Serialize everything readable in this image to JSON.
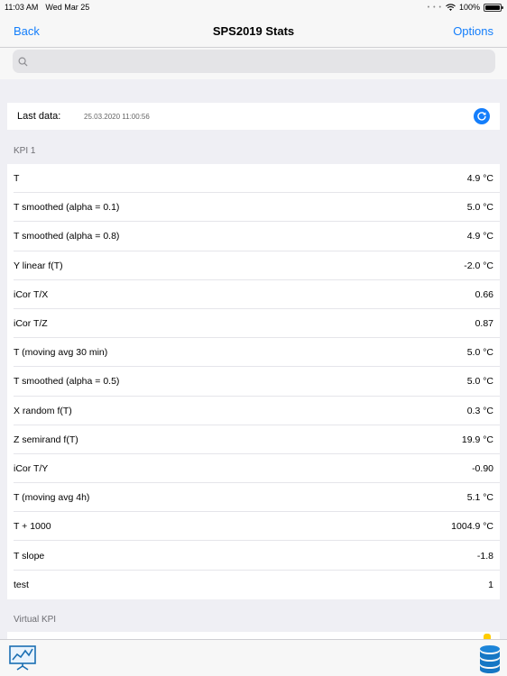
{
  "status_bar": {
    "time": "11:03 AM",
    "date": "Wed Mar 25",
    "battery": "100%",
    "battery_level": 1.0
  },
  "nav": {
    "back_label": "Back",
    "title": "SPS2019 Stats",
    "options_label": "Options"
  },
  "search": {
    "placeholder": "",
    "value": ""
  },
  "last_data": {
    "label": "Last data:",
    "value": "25.03.2020 11:00:56"
  },
  "sections": {
    "kpi1_title": "KPI 1",
    "virtual_title": "Virtual KPI"
  },
  "kpi1_rows": [
    {
      "name": "T",
      "value": "4.9 °C"
    },
    {
      "name": "T smoothed (alpha = 0.1)",
      "value": "5.0 °C"
    },
    {
      "name": "T smoothed (alpha = 0.8)",
      "value": "4.9 °C"
    },
    {
      "name": "Y linear f(T)",
      "value": "-2.0 °C"
    },
    {
      "name": "iCor T/X",
      "value": "0.66"
    },
    {
      "name": "iCor T/Z",
      "value": "0.87"
    },
    {
      "name": "T (moving avg 30 min)",
      "value": "5.0 °C"
    },
    {
      "name": "T smoothed (alpha = 0.5)",
      "value": "5.0 °C"
    },
    {
      "name": "X random f(T)",
      "value": "0.3 °C"
    },
    {
      "name": "Z semirand f(T)",
      "value": "19.9 °C"
    },
    {
      "name": "iCor T/Y",
      "value": "-0.90"
    },
    {
      "name": "T (moving avg 4h)",
      "value": "5.1 °C"
    },
    {
      "name": "T + 1000",
      "value": "1004.9 °C"
    },
    {
      "name": "T slope",
      "value": "-1.8"
    },
    {
      "name": "test",
      "value": "1"
    }
  ],
  "tabbar": {
    "left_icon": "chart-presentation-icon",
    "right_icon": "database-icon"
  },
  "colors": {
    "accent": "#147efb",
    "background": "#efeff4",
    "peek_badge": "#ffcc00"
  }
}
